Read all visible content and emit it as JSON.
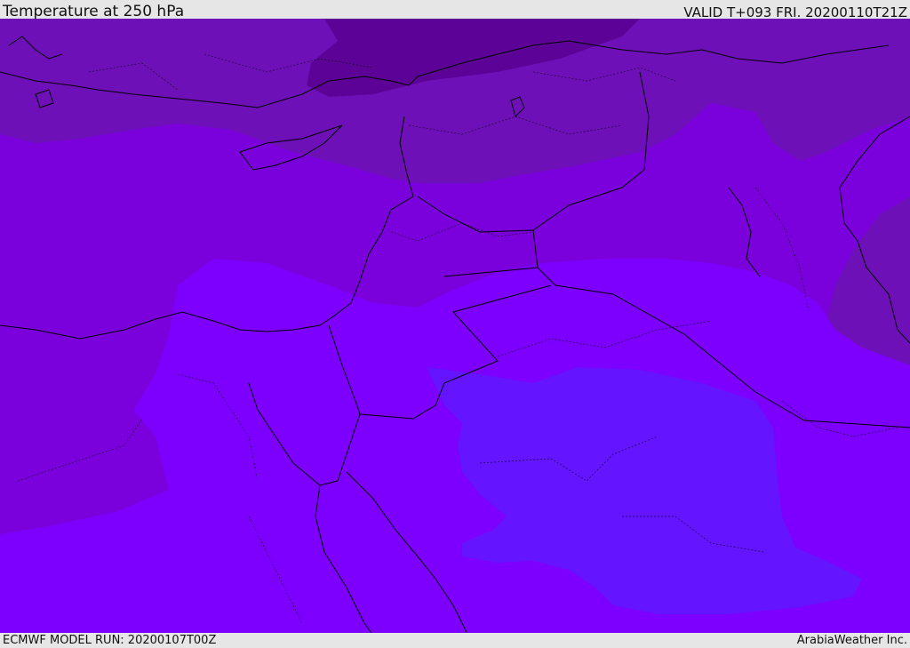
{
  "header": {
    "title": "Temperature at 250 hPa",
    "valid": "VALID T+093 FRI. 20200110T21Z"
  },
  "footer": {
    "model_run": "ECMWF MODEL RUN: 20200107T00Z",
    "credit": "ArabiaWeather Inc."
  },
  "map": {
    "colors": {
      "darkest_band": "#5c0296",
      "dark_band": "#6e10b8",
      "mid_band": "#7a00dc",
      "light_band": "#7d00ff",
      "lightest_band": "#6414ff",
      "coastline": "#000000"
    }
  }
}
